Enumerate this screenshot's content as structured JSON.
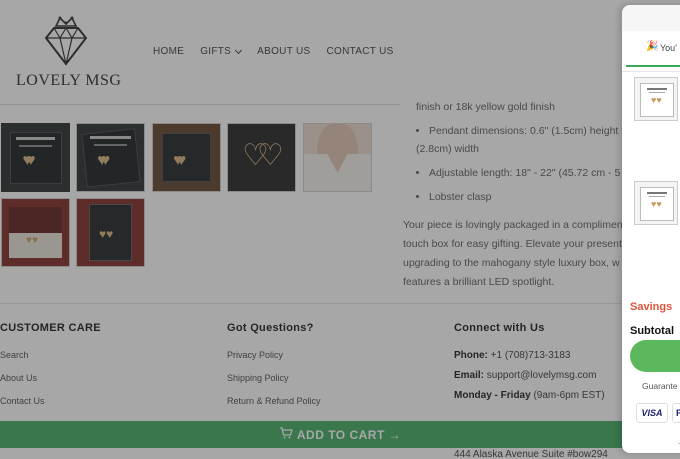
{
  "brand": {
    "name": "LOVELY MSG"
  },
  "nav": {
    "items": [
      "HOME",
      "GIFTS",
      "ABOUT US",
      "CONTACT US"
    ]
  },
  "product": {
    "details": [
      "finish or 18k yellow gold finish",
      "Pendant dimensions: 0.6\" (1.5cm) height x",
      "(2.8cm) width",
      "Adjustable length: 18\" - 22\" (45.72 cm - 5",
      "Lobster clasp"
    ],
    "packaging_lines": [
      "Your piece is lovingly packaged in a complimen",
      "touch box for easy gifting. Elevate your present",
      "upgrading to the mahogany style luxury box, w",
      "features a brilliant LED spotlight."
    ]
  },
  "footer": {
    "care": {
      "heading": "CUSTOMER CARE",
      "links": [
        "Search",
        "About Us",
        "Contact Us"
      ]
    },
    "questions": {
      "heading": "Got Questions?",
      "links": [
        "Privacy Policy",
        "Shipping Policy",
        "Return & Refund Policy"
      ]
    },
    "connect": {
      "heading": "Connect with Us",
      "phone_label": "Phone:",
      "phone": "+1 (708)713-3183",
      "email_label": "Email:",
      "email": "support@lovelymsg.com",
      "hours_label": "Monday - Friday",
      "hours": "(9am-6pm EST)",
      "address": "444 Alaska Avenue Suite #bow294"
    }
  },
  "sticky": {
    "add_to_cart": "ADD TO CART →"
  },
  "cart": {
    "banner": "You'",
    "savings_label": "Savings",
    "subtotal_label": "Subtotal",
    "guarantee_label": "Guarante",
    "payment_visa": "VISA",
    "payment_other": "P"
  },
  "colors": {
    "accent_green": "#3aa85b",
    "savings_red": "#e0533b"
  }
}
